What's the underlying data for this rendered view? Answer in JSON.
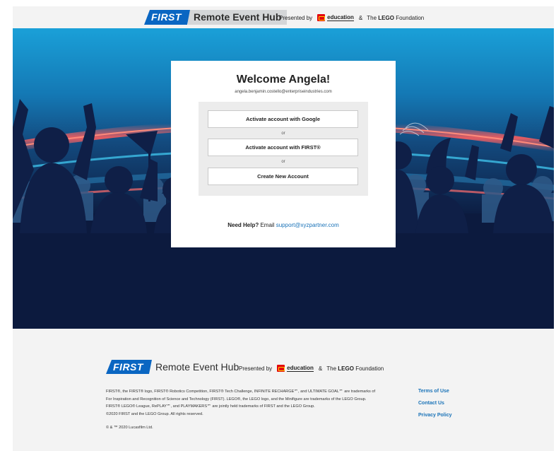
{
  "header": {
    "brand_first": "FIRST",
    "brand_name": "Remote Event Hub",
    "presented_by": "Presented by",
    "education": "education",
    "amp": "&",
    "lego_foundation_prefix": "The",
    "lego_foundation_bold": "LEGO",
    "lego_foundation_suffix": "Foundation"
  },
  "card": {
    "title": "Welcome Angela!",
    "email": "angela.benjamin.costello@enterpriseindustries.com",
    "buttons": [
      "Activate account with Google",
      "Activate account with FIRST®",
      "Create New Account"
    ],
    "or": "or",
    "help_label": "Need Help?",
    "help_text": "Email",
    "help_email": "support@xyzpartner.com"
  },
  "footer": {
    "brand_first": "FIRST",
    "brand_name": "Remote Event Hub",
    "presented_by": "Presented by",
    "education": "education",
    "amp": "&",
    "lego_foundation_prefix": "The",
    "lego_foundation_bold": "LEGO",
    "lego_foundation_suffix": "Foundation",
    "legal": [
      "FIRST®, the FIRST® logo, FIRST® Robotics Competition, FIRST® Tech Challenge, INFINITE RECHARGE℠, and ULTIMATE GOAL℠ are trademarks of",
      "For Inspiration and Recognition of Science and Technology (FIRST). LEGO®, the LEGO logo, and the Minifigure are trademarks of the LEGO Group.",
      "FIRST® LEGO® League, RePLAY℠, and PLAYMAKERS℠ are jointly held trademarks of FIRST and the LEGO Group.",
      "©2020 FIRST and the LEGO Group. All rights reserved."
    ],
    "copyright": "© & ™ 2020 Lucasfilm Ltd.",
    "links": [
      "Terms of Use",
      "Contact Us",
      "Privacy Policy"
    ]
  },
  "colors": {
    "first_blue": "#0a66c2",
    "link_blue": "#1a73b8",
    "hero_navy": "#0c1a3e",
    "lego_red": "#e3000b"
  }
}
